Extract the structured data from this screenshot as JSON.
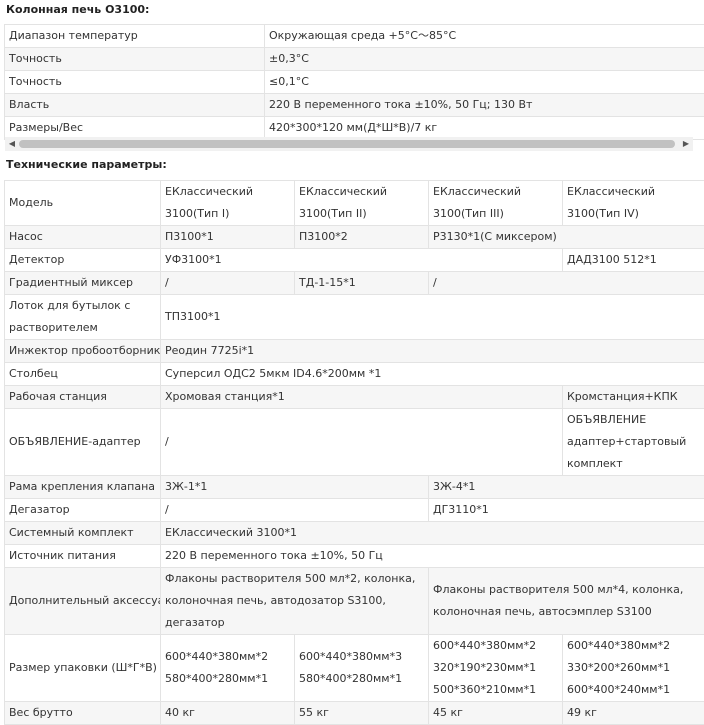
{
  "section1": {
    "title": "Колонная печь О3100:",
    "rows": [
      {
        "label": "Диапазон температур",
        "value": "Окружающая среда +5°C～85°C"
      },
      {
        "label": "Точность",
        "value": "±0,3°C"
      },
      {
        "label": "Точность",
        "value": "≤0,1°C"
      },
      {
        "label": "Власть",
        "value": "220 В переменного тока ±10%, 50 Гц; 130 Вт"
      },
      {
        "label": "Размеры/Вес",
        "value": "420*300*120 мм(Д*Ш*В)/7 кг"
      }
    ]
  },
  "scrollbar": {
    "left_arrow": "◀",
    "right_arrow": "▶"
  },
  "section2": {
    "title": "Технические параметры:",
    "model_label": "Модель",
    "models": [
      "EКлассический 3100(Тип I)",
      "EКлассический 3100(Тип II)",
      "EКлассический 3100(Тип III)",
      "EКлассический 3100(Тип IV)"
    ],
    "pump": {
      "label": "Насос",
      "c1": "П3100*1",
      "c2": "П3100*2",
      "c3": "Р3130*1(С миксером)"
    },
    "detector": {
      "label": "Детектор",
      "c1": "УФ3100*1",
      "c4": "ДАД3100 512*1"
    },
    "mixer": {
      "label": "Градиентный миксер",
      "c1": "/",
      "c2": "ТД-1-15*1",
      "c3": "/"
    },
    "bottle_tray": {
      "label": "Лоток для бутылок с растворителем",
      "c1": "ТП3100*1"
    },
    "injector": {
      "label": "Инжектор пробоотборника",
      "c1": "Реодин 7725i*1"
    },
    "column": {
      "label": "Столбец",
      "c1": "Суперсил ОДС2 5мкм ID4.6*200мм *1"
    },
    "workstation": {
      "label": "Рабочая станция",
      "c1": "Хромовая станция*1",
      "c4": "Кромстанция+КПК"
    },
    "adapter": {
      "label": "ОБЪЯВЛЕНИЕ-адаптер",
      "c1": "/",
      "c4": "ОБЪЯВЛЕНИЕ адаптер+стартовый комплект"
    },
    "valve_frame": {
      "label": "Рама крепления клапана",
      "c1": "3Ж-1*1",
      "c3": "3Ж-4*1"
    },
    "degasser": {
      "label": "Дегазатор",
      "c1": "/",
      "c3": "ДГ3110*1"
    },
    "system_kit": {
      "label": "Системный комплект",
      "c1": "EКлассический 3100*1"
    },
    "power": {
      "label": "Источник питания",
      "c1": "220 В переменного тока ±10%, 50 Гц"
    },
    "accessory": {
      "label": "Дополнительный аксессуар",
      "c1": "Флаконы растворителя 500 мл*2, колонка, колоночная печь, автодозатор S3100, дегазатор",
      "c3": "Флаконы растворителя 500 мл*4, колонка, колоночная печь, автосэмплер S3100"
    },
    "package": {
      "label": "Размер упаковки (Ш*Г*В)",
      "c1": [
        "600*440*380мм*2",
        "580*400*280мм*1"
      ],
      "c2": [
        "600*440*380мм*3",
        "580*400*280мм*1"
      ],
      "c3": [
        "600*440*380мм*2",
        "320*190*230мм*1",
        "500*360*210мм*1"
      ],
      "c4": [
        "600*440*380мм*2",
        "330*200*260мм*1",
        "600*400*240мм*1"
      ]
    },
    "gross_weight": {
      "label": "Вес брутто",
      "c1": "40 кг",
      "c2": "55 кг",
      "c3": "45 кг",
      "c4": "49 кг"
    }
  }
}
